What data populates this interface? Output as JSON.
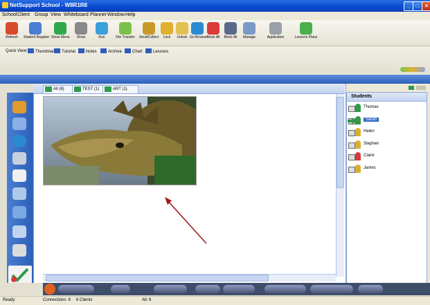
{
  "window": {
    "title": "NetSupport School - W8R1R8"
  },
  "menu": [
    "School",
    "Client",
    "Group",
    "View",
    "Whiteboard",
    "Planner",
    "Window",
    "Help"
  ],
  "toolbar": [
    {
      "label": "Refresh",
      "icon": "refresh-icon",
      "color": "#d84a2a"
    },
    {
      "label": "Student Register",
      "icon": "register-icon",
      "color": "#4a7ed1"
    },
    {
      "label": "Show Menu",
      "icon": "play-icon",
      "color": "#2fa84a"
    },
    {
      "label": "Show",
      "icon": "show-icon",
      "color": "#8a8a8a"
    },
    {
      "label": "Run",
      "icon": "run-icon",
      "color": "#3aa0d8"
    },
    {
      "label": "File Transfer",
      "icon": "file-transfer-icon",
      "color": "#7cc24a"
    },
    {
      "label": "Send/Collect",
      "icon": "send-collect-icon",
      "color": "#c89a2a"
    },
    {
      "label": "Lock",
      "icon": "lock-icon",
      "color": "#e0b030"
    },
    {
      "label": "Unlock",
      "icon": "unlock-icon",
      "color": "#e0c050"
    },
    {
      "label": "Go Browse",
      "icon": "globe-icon",
      "color": "#2a8ad0"
    },
    {
      "label": "Block All",
      "icon": "block-icon",
      "color": "#d83a3a"
    },
    {
      "label": "Block All",
      "icon": "monitor-icon",
      "color": "#5a6a8a"
    },
    {
      "label": "Manage",
      "icon": "manage-icon",
      "color": "#7a9ac8"
    },
    {
      "label": "Application",
      "icon": "application-icon",
      "color": "#9aa0a8"
    },
    {
      "label": "Lessons Plans",
      "icon": "lessons-icon",
      "color": "#4ab04a"
    }
  ],
  "quick_view": {
    "label": "Quick View:",
    "items": [
      "Thumbnail",
      "Tutorial",
      "Notes",
      "Archive",
      "Chart",
      "Lessons"
    ]
  },
  "tabs": [
    "All (6)",
    "TEST (1)",
    "ART (1)"
  ],
  "students": {
    "header": "Students",
    "items": [
      {
        "name": "Thomas",
        "color": "#2f9b4a",
        "selected": false
      },
      {
        "name": "Sarah",
        "color": "#2f9b4a",
        "selected": true
      },
      {
        "name": "Helen",
        "color": "#d8b030",
        "selected": false
      },
      {
        "name": "Stephen",
        "color": "#d8b030",
        "selected": false
      },
      {
        "name": "Claire",
        "color": "#d83a3a",
        "selected": false
      },
      {
        "name": "James",
        "color": "#d8b030",
        "selected": false
      }
    ]
  },
  "status": {
    "left": "Ready",
    "connections": "Connections: 6",
    "clients": "6 Clients",
    "right": "All: 6"
  },
  "colors": {
    "titlebar": "#0a4bd0",
    "accent": "#316ac5"
  }
}
